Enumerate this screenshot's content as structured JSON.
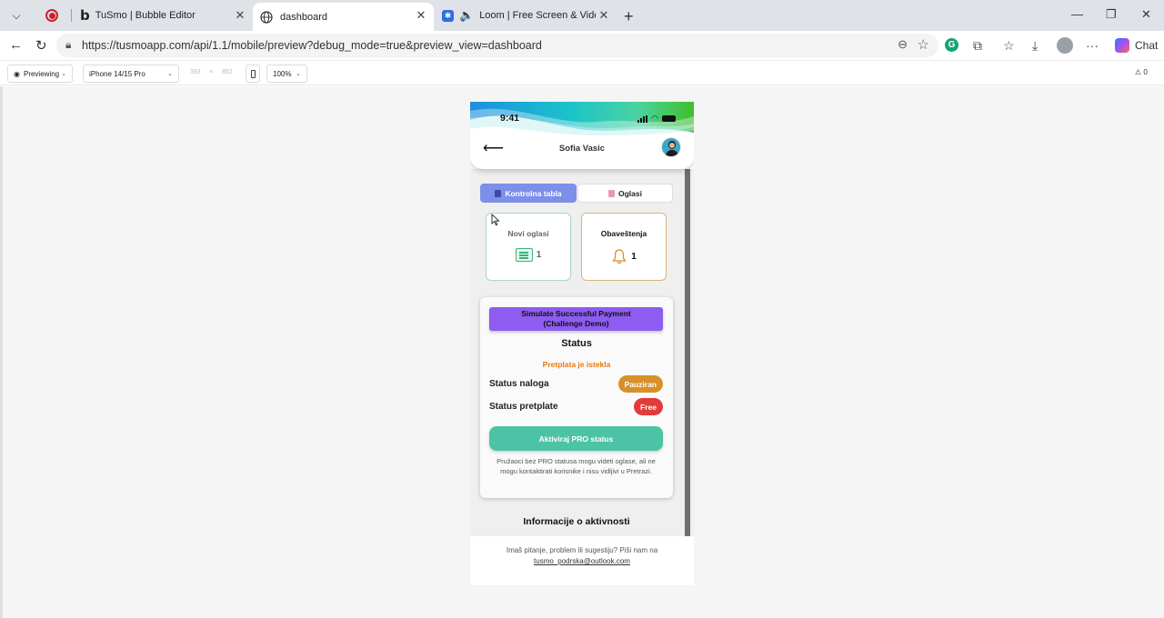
{
  "browser": {
    "tabs": [
      {
        "title": "TuSmo | Bubble Editor"
      },
      {
        "title": "dashboard"
      },
      {
        "title": "Loom | Free Screen & Video R"
      }
    ],
    "url": "https://tusmoapp.com/api/1.1/mobile/preview?debug_mode=true&preview_view=dashboard",
    "chat_label": "Chat",
    "icons": [
      "chevron-down-icon",
      "record-icon",
      "bubble-icon",
      "globe-icon",
      "loom-icon",
      "speaker-icon",
      "close-icon",
      "plus-icon",
      "back-icon",
      "reload-icon",
      "lock-icon",
      "zoom-icon",
      "star-icon",
      "grammarly-icon",
      "puzzle-icon",
      "favorites-icon",
      "download-icon",
      "profile-icon",
      "more-icon",
      "copilot-icon"
    ]
  },
  "preview_bar": {
    "mode": "Previewing",
    "device": "iPhone 14/15 Pro",
    "width": "393",
    "times": "×",
    "height": "852",
    "zoom": "100%",
    "warnings": "0"
  },
  "phone": {
    "status_time": "9:41",
    "user_name": "Sofia Vasic",
    "tabs": {
      "active": "Kontrolna tabla",
      "inactive": "Oglasi"
    },
    "tiles": [
      {
        "title": "Novi oglasi",
        "count": "1"
      },
      {
        "title": "Obaveštenja",
        "count": "1"
      }
    ],
    "card": {
      "pay_line1": "Simulate Successful Payment",
      "pay_line2": "(Challenge Demo)",
      "title": "Status",
      "expired_text": "Pretplata je istekla",
      "account_label": "Status naloga",
      "account_badge": "Pauziran",
      "subscription_label": "Status pretplate",
      "subscription_badge": "Free",
      "pro_button": "Aktiviraj PRO status",
      "note": "Pružaoci bez PRO statusa mogu videti oglase, ali ne mogu kontaktirati korisnike i nisu vidljivi u Pretrazi."
    },
    "activity_title": "Informacije o aktivnosti",
    "footer": {
      "question": "Imaš pitanje, problem ili sugestiju? Piši nam na",
      "email": "tusmo_podrska@outlook.com"
    }
  },
  "colors": {
    "tab_active": "#7d8fe8",
    "pay_button": "#8d5cf0",
    "pro_button": "#4dc3a5",
    "badge_paused": "#d7902a",
    "badge_free": "#e23b3b",
    "expired_text": "#e8790f",
    "tile_green_border": "#a9d8bd",
    "tile_orange_border": "#d8b47a"
  }
}
